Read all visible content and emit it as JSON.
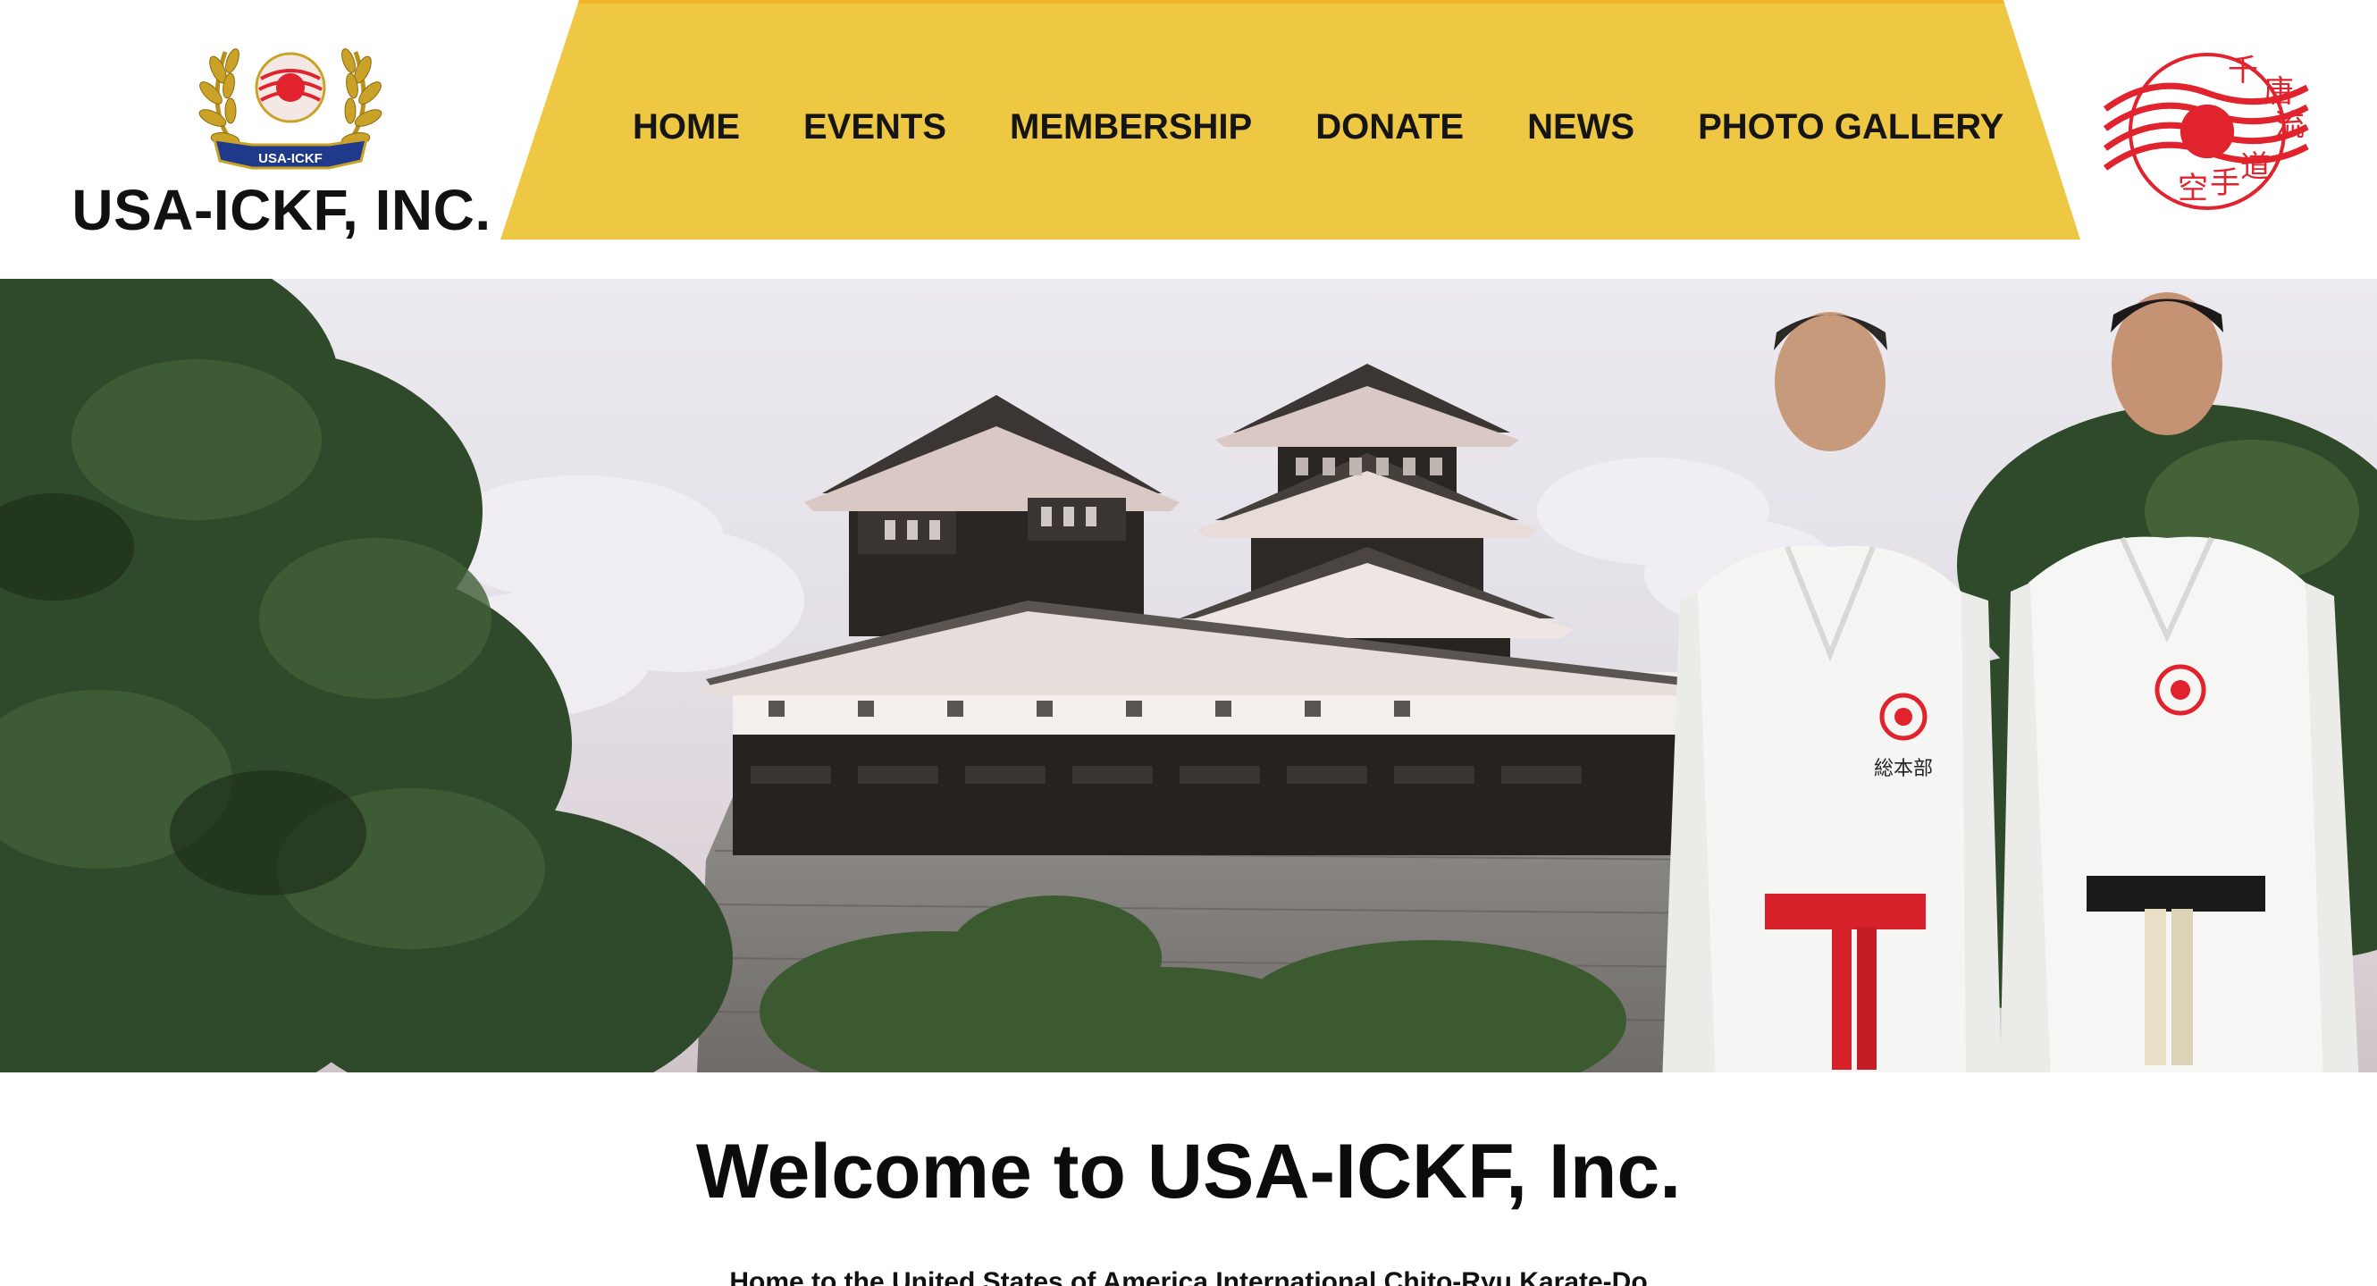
{
  "header": {
    "site_name": "USA-ICKF, INC.",
    "emblem_ribbon_text": "USA-ICKF",
    "nav": [
      {
        "label": "HOME"
      },
      {
        "label": "EVENTS"
      },
      {
        "label": "MEMBERSHIP"
      },
      {
        "label": "DONATE"
      },
      {
        "label": "NEWS"
      },
      {
        "label": "PHOTO GALLERY"
      }
    ],
    "style_logo_glyphs": [
      "千",
      "唐",
      "流",
      "空",
      "手",
      "道"
    ]
  },
  "hero": {
    "gi_patch_text": "総本部"
  },
  "welcome": {
    "title": "Welcome to USA-ICKF, Inc.",
    "subtitle": "Home to the United States of America International Chito-Ryu Karate-Do"
  },
  "colors": {
    "nav_band": "#efc843",
    "accent_red": "#e0232d",
    "text": "#111111",
    "background": "#ffffff"
  },
  "icons": {
    "emblem": "laurel-wreath-emblem-icon",
    "style_logo": "chito-ryu-crest-icon"
  }
}
